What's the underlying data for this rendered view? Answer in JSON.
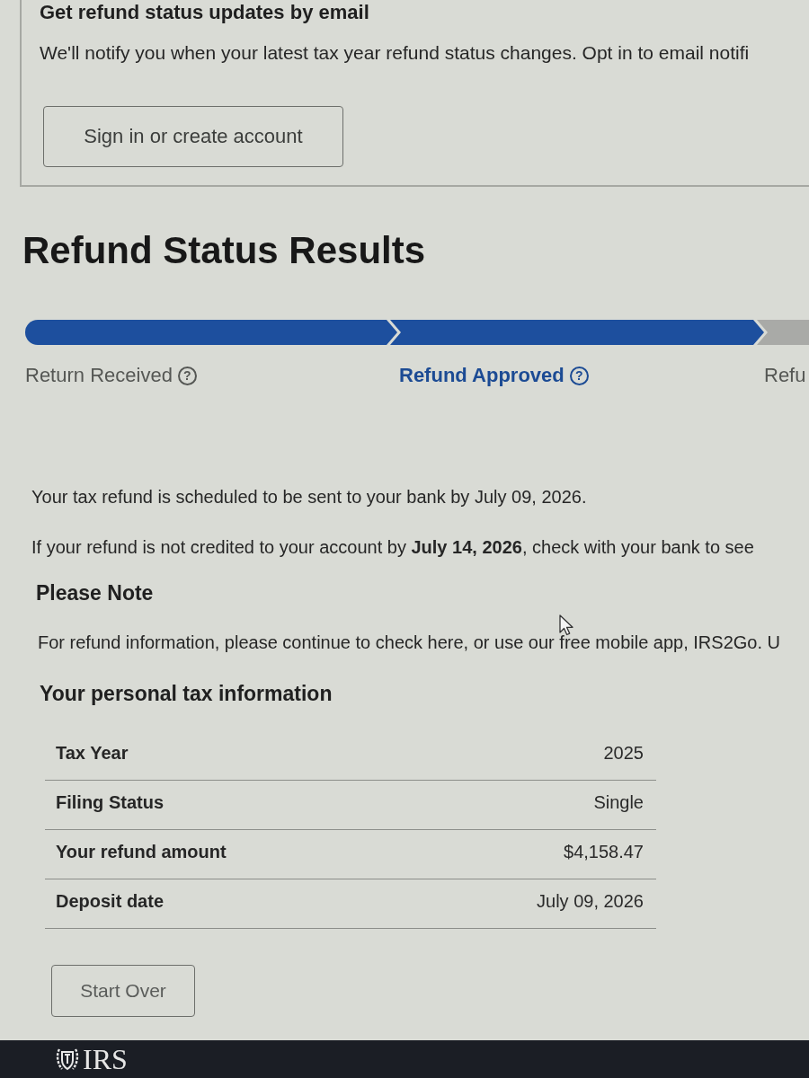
{
  "email_updates": {
    "heading": "Get refund status updates by email",
    "text": "We'll notify you when your latest tax year refund status changes. Opt in to email notifi",
    "button": "Sign in or create account"
  },
  "title": "Refund Status Results",
  "progress": {
    "steps": [
      {
        "label": "Return Received",
        "completed": true,
        "selected": false,
        "help_button": "?"
      },
      {
        "label": "Refund Approved",
        "completed": true,
        "selected": true,
        "help_button": "?"
      },
      {
        "label": "Refu",
        "completed": false,
        "selected": false
      }
    ]
  },
  "messages": [
    "Your tax refund is scheduled to be sent to your bank by July 09, 2026.",
    "If your refund is not credited to your account by **July 14, 2026**, check with your bank to see"
  ],
  "note": {
    "heading": "Please Note",
    "text": "For refund information, please continue to check here, or use our free mobile app, IRS2Go. U"
  },
  "tax_info": {
    "heading": "Your personal tax information",
    "rows": [
      {
        "label": "Tax Year",
        "value": "2025"
      },
      {
        "label": "Filing Status",
        "value": "Single"
      },
      {
        "label": "Your refund amount",
        "value": "$4,158.47"
      },
      {
        "label": "Deposit date",
        "value": "July 09, 2026"
      }
    ]
  },
  "start_over_button": "Start Over",
  "footer": {
    "logo_text": "IRS"
  }
}
